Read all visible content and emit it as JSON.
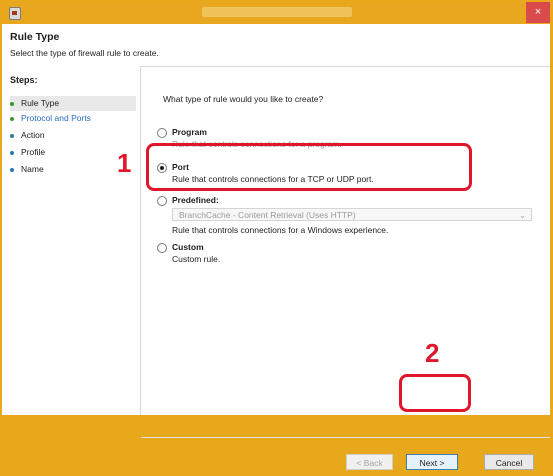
{
  "window": {
    "title": "",
    "close": "×"
  },
  "header": {
    "title": "Rule Type",
    "subtitle": "Select the type of firewall rule to create."
  },
  "steps": {
    "title": "Steps:",
    "items": [
      {
        "label": "Rule Type"
      },
      {
        "label": "Protocol and Ports"
      },
      {
        "label": "Action"
      },
      {
        "label": "Profile"
      },
      {
        "label": "Name"
      }
    ]
  },
  "main": {
    "question": "What type of rule would you like to create?",
    "options": [
      {
        "label": "Program",
        "desc": "Rule that controls connections for a program.",
        "selected": false
      },
      {
        "label": "Port",
        "desc": "Rule that controls connections for a TCP or UDP port.",
        "selected": true
      },
      {
        "label": "Predefined:",
        "desc": "Rule that controls connections for a Windows experience.",
        "selected": false,
        "select_value": "BranchCache - Content Retrieval (Uses HTTP)"
      },
      {
        "label": "Custom",
        "desc": "Custom rule.",
        "selected": false
      }
    ]
  },
  "buttons": {
    "back": "< Back",
    "next": "Next >",
    "cancel": "Cancel"
  },
  "annotations": {
    "marker1": "1",
    "marker2": "2",
    "color": "#e0162b"
  }
}
